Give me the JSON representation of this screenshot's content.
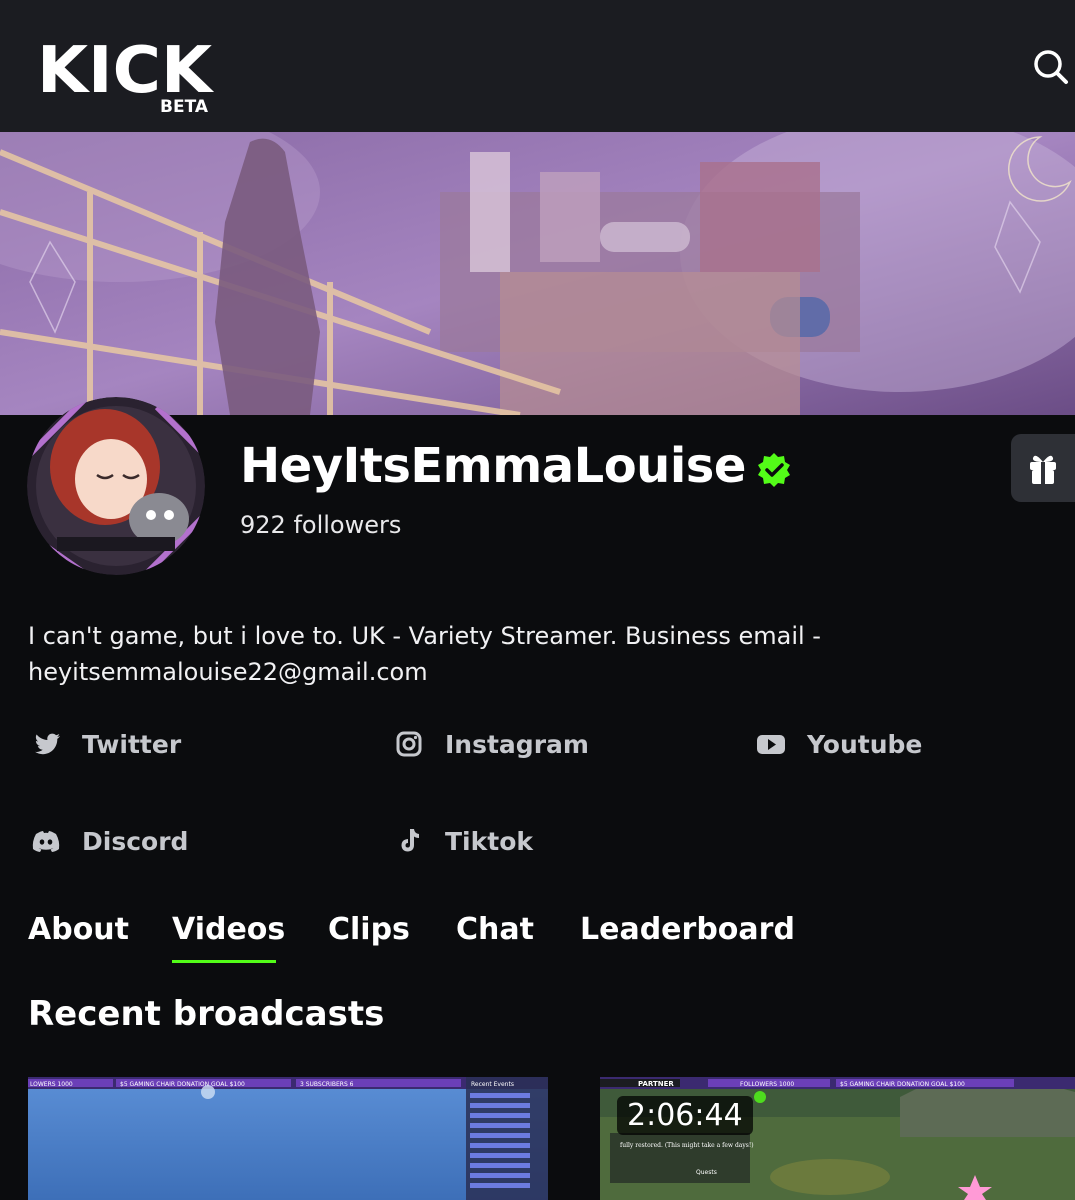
{
  "header": {
    "logo_text": "KICK",
    "beta_badge": "BETA"
  },
  "channel": {
    "name": "HeyItsEmmaLouise",
    "followers": "922 followers",
    "verified": true,
    "bio_line1": "I can't game, but i love to. UK - Variety Streamer. Business email -",
    "bio_line2": "heyitsemmalouise22@gmail.com"
  },
  "socials": [
    {
      "label": "Twitter",
      "icon": "twitter-icon"
    },
    {
      "label": "Instagram",
      "icon": "instagram-icon"
    },
    {
      "label": "Youtube",
      "icon": "youtube-icon"
    },
    {
      "label": "Discord",
      "icon": "discord-icon"
    },
    {
      "label": "Tiktok",
      "icon": "tiktok-icon"
    }
  ],
  "tabs": [
    {
      "label": "About",
      "active": false
    },
    {
      "label": "Videos",
      "active": true
    },
    {
      "label": "Clips",
      "active": false
    },
    {
      "label": "Chat",
      "active": false
    },
    {
      "label": "Leaderboard",
      "active": false
    }
  ],
  "section": {
    "title": "Recent broadcasts"
  },
  "broadcasts": [
    {
      "overlay_text": [
        "LOWERS 1000",
        "$5 GAMING CHAIR DONATION GOAL $100",
        "3 SUBSCRIBERS 6",
        "Recent Events"
      ]
    },
    {
      "duration": "2:06:44",
      "overlay_text": [
        "PARTNER",
        "FOLLOWERS 1000",
        "$5 GAMING CHAIR DONATION GOAL $100",
        "fully restored. (This might take a few days!)",
        "Quests"
      ]
    }
  ],
  "colors": {
    "accent": "#53fc18",
    "topbar": "#1b1c21",
    "background": "#0b0c0e",
    "social_text": "#c6c8cd"
  }
}
